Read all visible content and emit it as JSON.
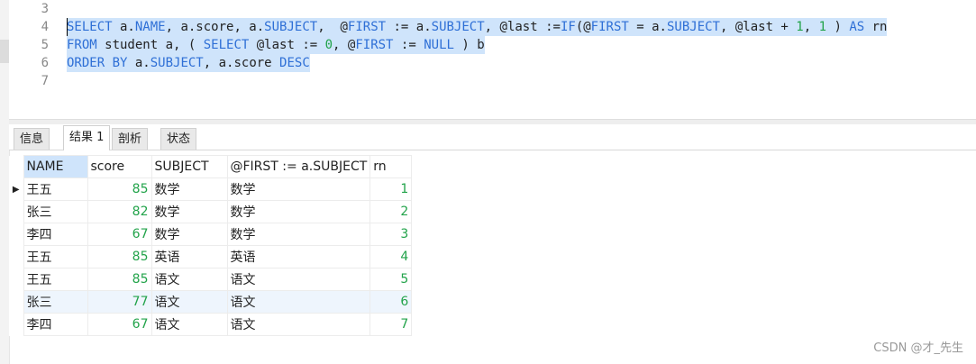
{
  "editor": {
    "line_numbers": [
      "3",
      "4",
      "5",
      "6",
      "7"
    ],
    "line4": {
      "p1": "SELECT",
      "p2": " a.",
      "p3": "NAME",
      "p4": ", a.score, a.",
      "p5": "SUBJECT",
      "p6": ",  @",
      "p7": "FIRST",
      "p8": " := a.",
      "p9": "SUBJECT",
      "p10": ", @last :=",
      "p11": "IF",
      "p12": "(@",
      "p13": "FIRST",
      "p14": " = a.",
      "p15": "SUBJECT",
      "p16": ", @last + ",
      "p17": "1",
      "p18": ", ",
      "p19": "1",
      "p20": " ) ",
      "p21": "AS",
      "p22": " rn"
    },
    "line5": {
      "p1": "FROM",
      "p2": " student a, ( ",
      "p3": "SELECT",
      "p4": " @last := ",
      "p5": "0",
      "p6": ", @",
      "p7": "FIRST",
      "p8": " := ",
      "p9": "NULL",
      "p10": " ) b"
    },
    "line6": {
      "p1": "ORDER BY",
      "p2": " a.",
      "p3": "SUBJECT",
      "p4": ", a.score ",
      "p5": "DESC"
    }
  },
  "tabs": [
    "信息",
    "结果 1",
    "剖析",
    "状态"
  ],
  "result": {
    "columns": [
      "NAME",
      "score",
      "SUBJECT",
      "@FIRST := a.SUBJECT",
      "rn"
    ],
    "rows": [
      [
        "王五",
        "85",
        "数学",
        "数学",
        "1"
      ],
      [
        "张三",
        "82",
        "数学",
        "数学",
        "2"
      ],
      [
        "李四",
        "67",
        "数学",
        "数学",
        "3"
      ],
      [
        "王五",
        "85",
        "英语",
        "英语",
        "4"
      ],
      [
        "王五",
        "85",
        "语文",
        "语文",
        "5"
      ],
      [
        "张三",
        "77",
        "语文",
        "语文",
        "6"
      ],
      [
        "李四",
        "67",
        "语文",
        "语文",
        "7"
      ]
    ]
  },
  "watermark": "CSDN @才_先生",
  "colors": {
    "keyword": "#2e6fd6",
    "number": "#22a34a",
    "selection": "#cfe4fb"
  },
  "icons": {
    "row_marker": "current-row-arrow"
  }
}
